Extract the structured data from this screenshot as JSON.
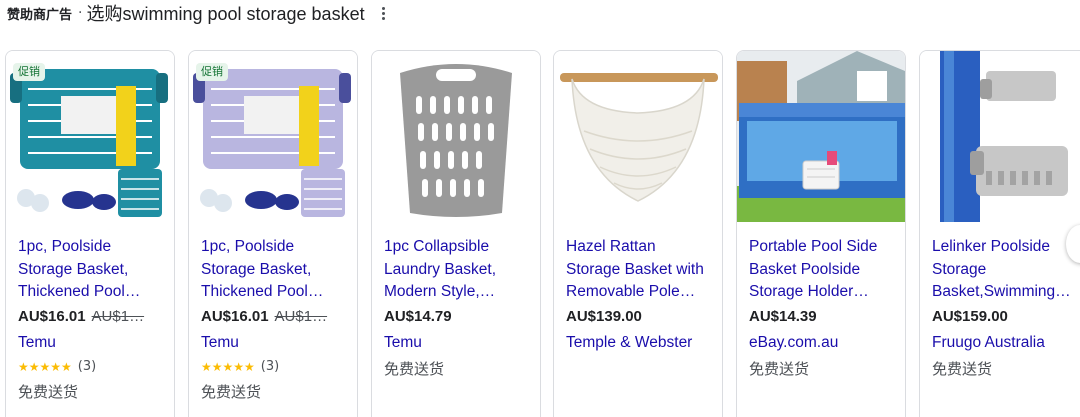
{
  "header": {
    "sponsor": "赞助商广告",
    "separator": "·",
    "query": "选购swimming pool storage basket"
  },
  "products": [
    {
      "badge": "促销",
      "image_icon": "teal-plastic-basket-with-accessories",
      "title_lines": [
        "1pc, Poolside",
        "Storage Basket,",
        "Thickened Pool…"
      ],
      "price": "AU$16.01",
      "old_price": "AU$1…",
      "seller": "Temu",
      "stars": "★★★★★",
      "reviews": "(3)",
      "shipping": "免费送货"
    },
    {
      "badge": "促销",
      "image_icon": "lavender-plastic-basket-with-accessories",
      "title_lines": [
        "1pc, Poolside",
        "Storage Basket,",
        "Thickened Pool…"
      ],
      "price": "AU$16.01",
      "old_price": "AU$1…",
      "seller": "Temu",
      "stars": "★★★★★",
      "reviews": "(3)",
      "shipping": "免费送货"
    },
    {
      "badge": "",
      "image_icon": "grey-collapsible-laundry-basket",
      "title_lines": [
        "1pc Collapsible",
        "Laundry Basket,",
        "Modern Style,…"
      ],
      "price": "AU$14.79",
      "old_price": "",
      "seller": "Temu",
      "stars": "",
      "reviews": "",
      "shipping": "免费送货"
    },
    {
      "badge": "",
      "image_icon": "white-rattan-basket-on-pole",
      "title_lines": [
        "Hazel Rattan",
        "Storage Basket with",
        "Removable Pole…"
      ],
      "price": "AU$139.00",
      "old_price": "",
      "seller": "Temple & Webster",
      "stars": "",
      "reviews": "",
      "shipping": ""
    },
    {
      "badge": "",
      "image_icon": "above-ground-pool-with-side-basket",
      "title_lines": [
        "Portable Pool Side",
        "Basket Poolside",
        "Storage Holder…"
      ],
      "price": "AU$14.39",
      "old_price": "",
      "seller": "eBay.com.au",
      "stars": "",
      "reviews": "",
      "shipping": "免费送货"
    },
    {
      "badge": "",
      "image_icon": "grey-poolside-tray-holders",
      "title_lines": [
        "Lelinker Poolside",
        "Storage",
        "Basket,Swimming…"
      ],
      "price": "AU$159.00",
      "old_price": "",
      "seller": "Fruugo Australia",
      "stars": "",
      "reviews": "",
      "shipping": "免费送货"
    }
  ],
  "colors": {
    "title_link": "#1a0dab",
    "star": "#fbbc04",
    "promo_bg": "#e6f4ea",
    "promo_text": "#137333",
    "card_border": "#dadce0"
  }
}
